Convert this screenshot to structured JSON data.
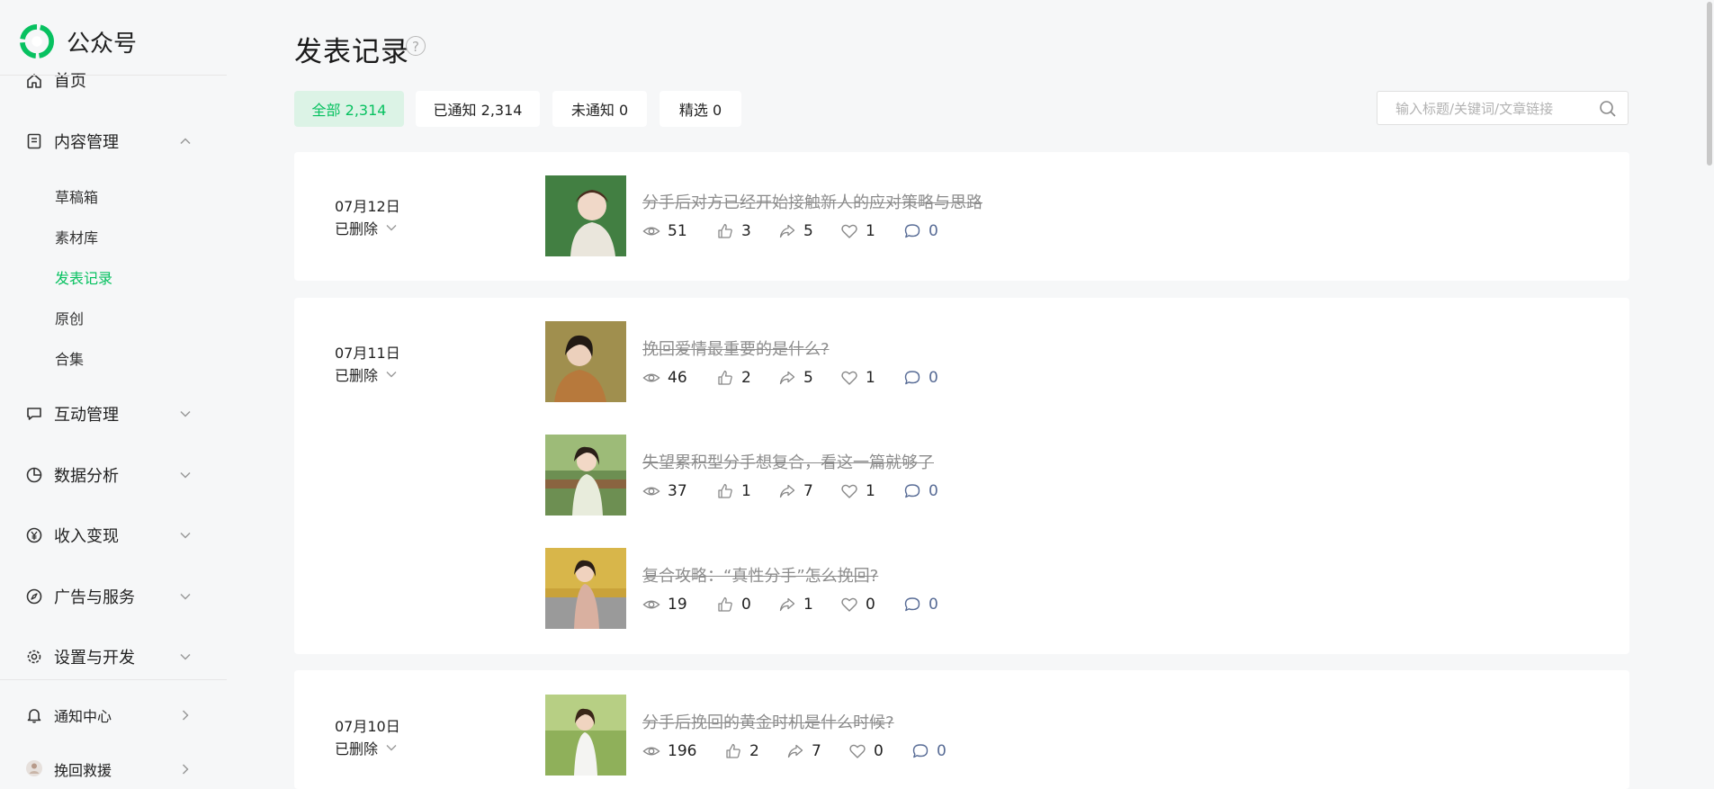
{
  "brand": {
    "name": "公众号"
  },
  "sidebar": {
    "home_label": "首页",
    "content_mgmt": {
      "label": "内容管理",
      "children": [
        {
          "label": "草稿箱",
          "active": false
        },
        {
          "label": "素材库",
          "active": false
        },
        {
          "label": "发表记录",
          "active": true
        },
        {
          "label": "原创",
          "active": false
        },
        {
          "label": "合集",
          "active": false
        }
      ]
    },
    "groups": [
      {
        "label": "互动管理",
        "icon": "message-icon"
      },
      {
        "label": "数据分析",
        "icon": "pie-chart-icon"
      },
      {
        "label": "收入变现",
        "icon": "yen-icon"
      },
      {
        "label": "广告与服务",
        "icon": "compass-icon"
      },
      {
        "label": "设置与开发",
        "icon": "gear-icon"
      }
    ],
    "notification_label": "通知中心",
    "rescue_label": "挽回救援"
  },
  "page": {
    "title": "发表记录",
    "help_glyph": "?"
  },
  "tabs": [
    {
      "label": "全部 2,314",
      "active": true
    },
    {
      "label": "已通知 2,314",
      "active": false
    },
    {
      "label": "未通知 0",
      "active": false
    },
    {
      "label": "精选 0",
      "active": false
    }
  ],
  "search": {
    "placeholder": "输入标题/关键词/文章链接",
    "value": ""
  },
  "records": [
    {
      "date": "07月12日",
      "status": "已删除",
      "articles": [
        {
          "title": "分手后对方已经开始接触新人的应对策略与思路",
          "views": "51",
          "likes": "3",
          "shares": "5",
          "favs": "1",
          "comments": "0"
        }
      ]
    },
    {
      "date": "07月11日",
      "status": "已删除",
      "articles": [
        {
          "title": "挽回爱情最重要的是什么?",
          "views": "46",
          "likes": "2",
          "shares": "5",
          "favs": "1",
          "comments": "0"
        },
        {
          "title": "失望累积型分手想复合，看这一篇就够了",
          "views": "37",
          "likes": "1",
          "shares": "7",
          "favs": "1",
          "comments": "0"
        },
        {
          "title": "复合攻略：“真性分手”怎么挽回?",
          "views": "19",
          "likes": "0",
          "shares": "1",
          "favs": "0",
          "comments": "0"
        }
      ]
    },
    {
      "date": "07月10日",
      "status": "已删除",
      "articles": [
        {
          "title": "分手后挽回的黄金时机是什么时候?",
          "views": "196",
          "likes": "2",
          "shares": "7",
          "favs": "0",
          "comments": "0"
        }
      ]
    }
  ],
  "colors": {
    "accent": "#07c160",
    "comment": "#576b95",
    "background": "#f6f7f8"
  }
}
